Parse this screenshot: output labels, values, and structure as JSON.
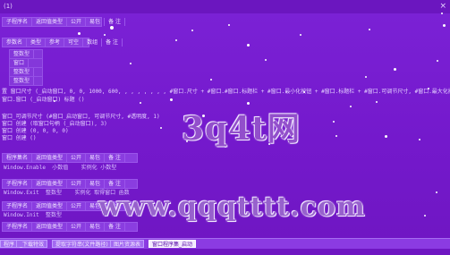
{
  "window": {
    "title": "(1)",
    "close_label": "×"
  },
  "tables": [
    {
      "headers": [
        "子程序名",
        "返回值类型",
        "公开",
        "易包",
        "备 注"
      ]
    },
    {
      "headers": [
        "参数名",
        "类型",
        "参考",
        "可空",
        "数组",
        "备 注"
      ]
    },
    {
      "headers": [
        "程序集名",
        "返回值类型",
        "公开",
        "易包",
        "备 注"
      ]
    },
    {
      "headers": [
        "子程序名",
        "返回值类型",
        "公开",
        "易包",
        "备 注"
      ]
    },
    {
      "headers": [
        "子程序名",
        "返回值类型",
        "公开",
        "易包",
        "备 注"
      ]
    },
    {
      "headers": [
        "子程序名",
        "返回值类型",
        "公开",
        "易包",
        "备 注"
      ]
    }
  ],
  "code": {
    "param_rows": [
      "整数型",
      "窗口",
      "整数型",
      "整数型"
    ],
    "line1": "置 窗口尺寸 (_启动窗口, 0, 0, 1000, 600, , , , , , , , #窗口.尺寸 + #窗口.#窗口.标题栏 + #窗口.最小化按钮 + #窗口.标题栏 + #窗口.可调节尺寸, #窗口.最大化按钮 + #窗口.关闭按钮 + #窗口.无边框, #窗口.置顶)",
    "line2": "窗口.窗口 (_启动窗口) 标题 ()",
    "line3": "窗口_可调节尺寸 (#窗口_启动窗口, 可调节尺寸, #透明度, 1)",
    "line4": "窗口 创建 (取窗口句柄 (_启动窗口), 3)",
    "line5": "窗口 创建 (0, 0, 0, 0)",
    "line6": "窗口 创建 ()",
    "row_a": [
      "Window.Enable",
      "小数值"
    ],
    "row_b": [
      "Window.Exit",
      "整数型"
    ],
    "row_c": [
      "Window.Init",
      "整数型"
    ],
    "note_a": "实例化 小数型",
    "note_b": "实例化 取得窗口 函数"
  },
  "watermarks": {
    "logo": "3q4t网",
    "url": "www.qqqtttt.com"
  },
  "tabs": {
    "items": [
      {
        "label": "程序"
      },
      {
        "label": "_下载特效"
      },
      {
        "label": "提取字符串(文件路径)"
      },
      {
        "label": "图片资源表"
      },
      {
        "label": "窗口程序集_启动"
      }
    ],
    "active_index": 4
  },
  "colors": {
    "background": "#7b22d6",
    "accent": "#8a3de0",
    "snow": "#ffffff"
  }
}
